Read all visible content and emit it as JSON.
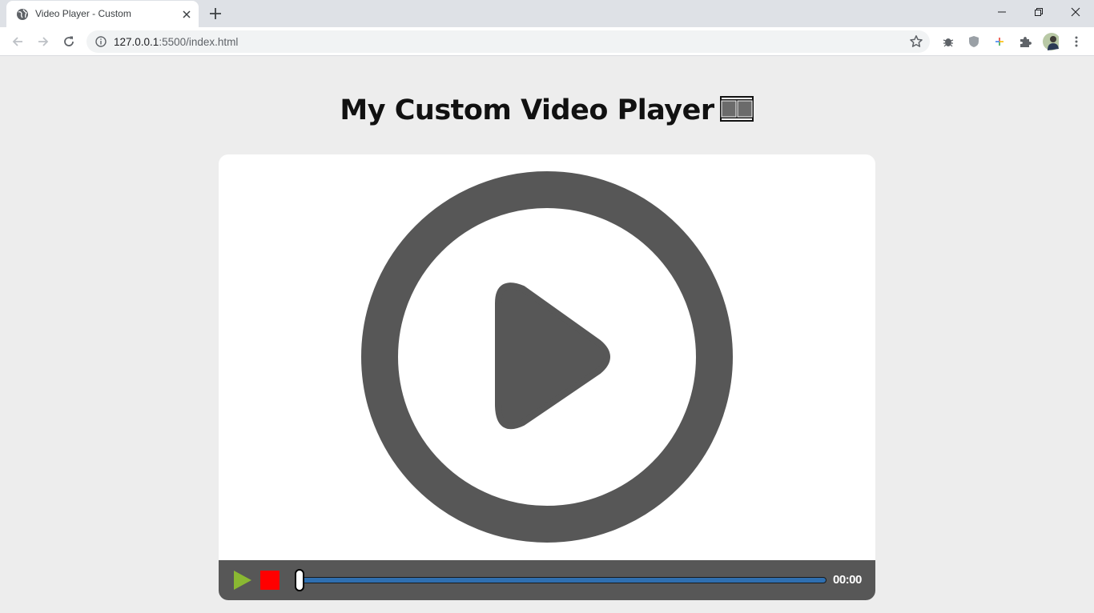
{
  "browser": {
    "tab_title": "Video Player - Custom",
    "url_host": "127.0.0.1",
    "url_rest": ":5500/index.html"
  },
  "page": {
    "heading": "My Custom Video Player"
  },
  "player": {
    "timestamp": "00:00",
    "progress_fraction": 0,
    "play_color": "#8ab832",
    "stop_color": "#ff0000",
    "track_color": "#2f6fb0",
    "poster_color": "#575757"
  }
}
